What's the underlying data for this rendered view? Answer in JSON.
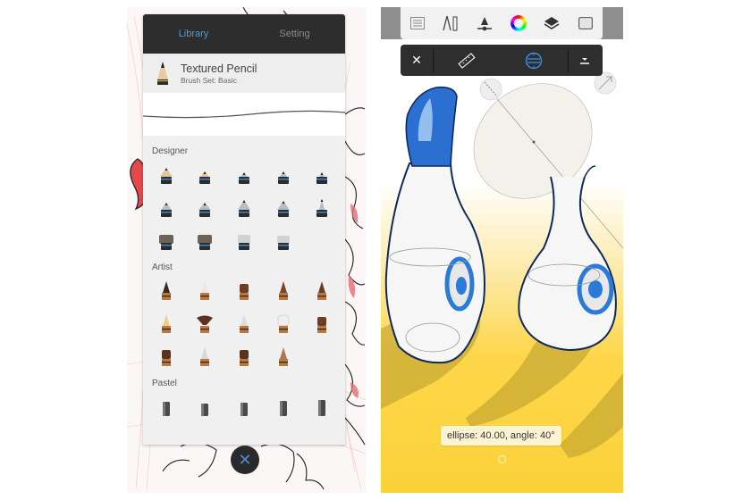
{
  "left_screen": {
    "tabs": [
      {
        "label": "Library",
        "active": true
      },
      {
        "label": "Setting",
        "active": false
      }
    ],
    "current_brush": {
      "name": "Textured Pencil",
      "brush_set": "Brush Set: Basic",
      "icon": "pencil-icon"
    },
    "sections": [
      {
        "label": "Designer",
        "brushes": [
          "pencil-icon",
          "short-pencil-icon",
          "fine-liner-icon",
          "technical-pen-icon",
          "small-marker-icon",
          "ink-pen-icon",
          "chisel-marker-icon",
          "double-marker-icon",
          "wedge-marker-icon",
          "ballpoint-icon",
          "flat-brush-icon",
          "square-brush-icon",
          "airbrush-icon",
          "round-airbrush-icon"
        ]
      },
      {
        "label": "Artist",
        "brushes": [
          "art-pencil-icon",
          "graphite-pencil-icon",
          "flat-nib-icon",
          "round-brush-icon",
          "pointed-brush-icon",
          "fountain-pen-icon",
          "fan-brush-icon",
          "palette-knife-icon",
          "bristle-brush-icon",
          "filbert-brush-icon",
          "wide-flat-brush-icon",
          "angled-brush-icon",
          "dry-brush-icon",
          "blender-brush-icon"
        ]
      },
      {
        "label": "Pastel",
        "brushes": [
          "pastel-stick-icon",
          "soft-pastel-icon",
          "oil-pastel-icon",
          "chalk-icon",
          "charcoal-icon"
        ]
      }
    ],
    "close_button": {
      "icon": "close-icon",
      "glyph": "✕"
    },
    "accent_color": "#4a9ae4"
  },
  "right_screen": {
    "main_toolbar": [
      {
        "name": "brush-library-icon"
      },
      {
        "name": "guides-ruler-icon"
      },
      {
        "name": "brush-properties-icon"
      },
      {
        "name": "color-wheel-icon"
      },
      {
        "name": "layers-icon"
      },
      {
        "name": "fullscreen-icon"
      }
    ],
    "guide_toolbar": {
      "close_glyph": "✕",
      "items": [
        {
          "name": "ruler-guide-icon",
          "active": false
        },
        {
          "name": "ellipse-guide-icon",
          "active": true
        },
        {
          "name": "guide-menu-icon",
          "active": false
        }
      ]
    },
    "readout": "ellipse: 40.00, angle: 40°",
    "accent_color": "#2f7fd0",
    "background_color": "#fcd23a"
  }
}
